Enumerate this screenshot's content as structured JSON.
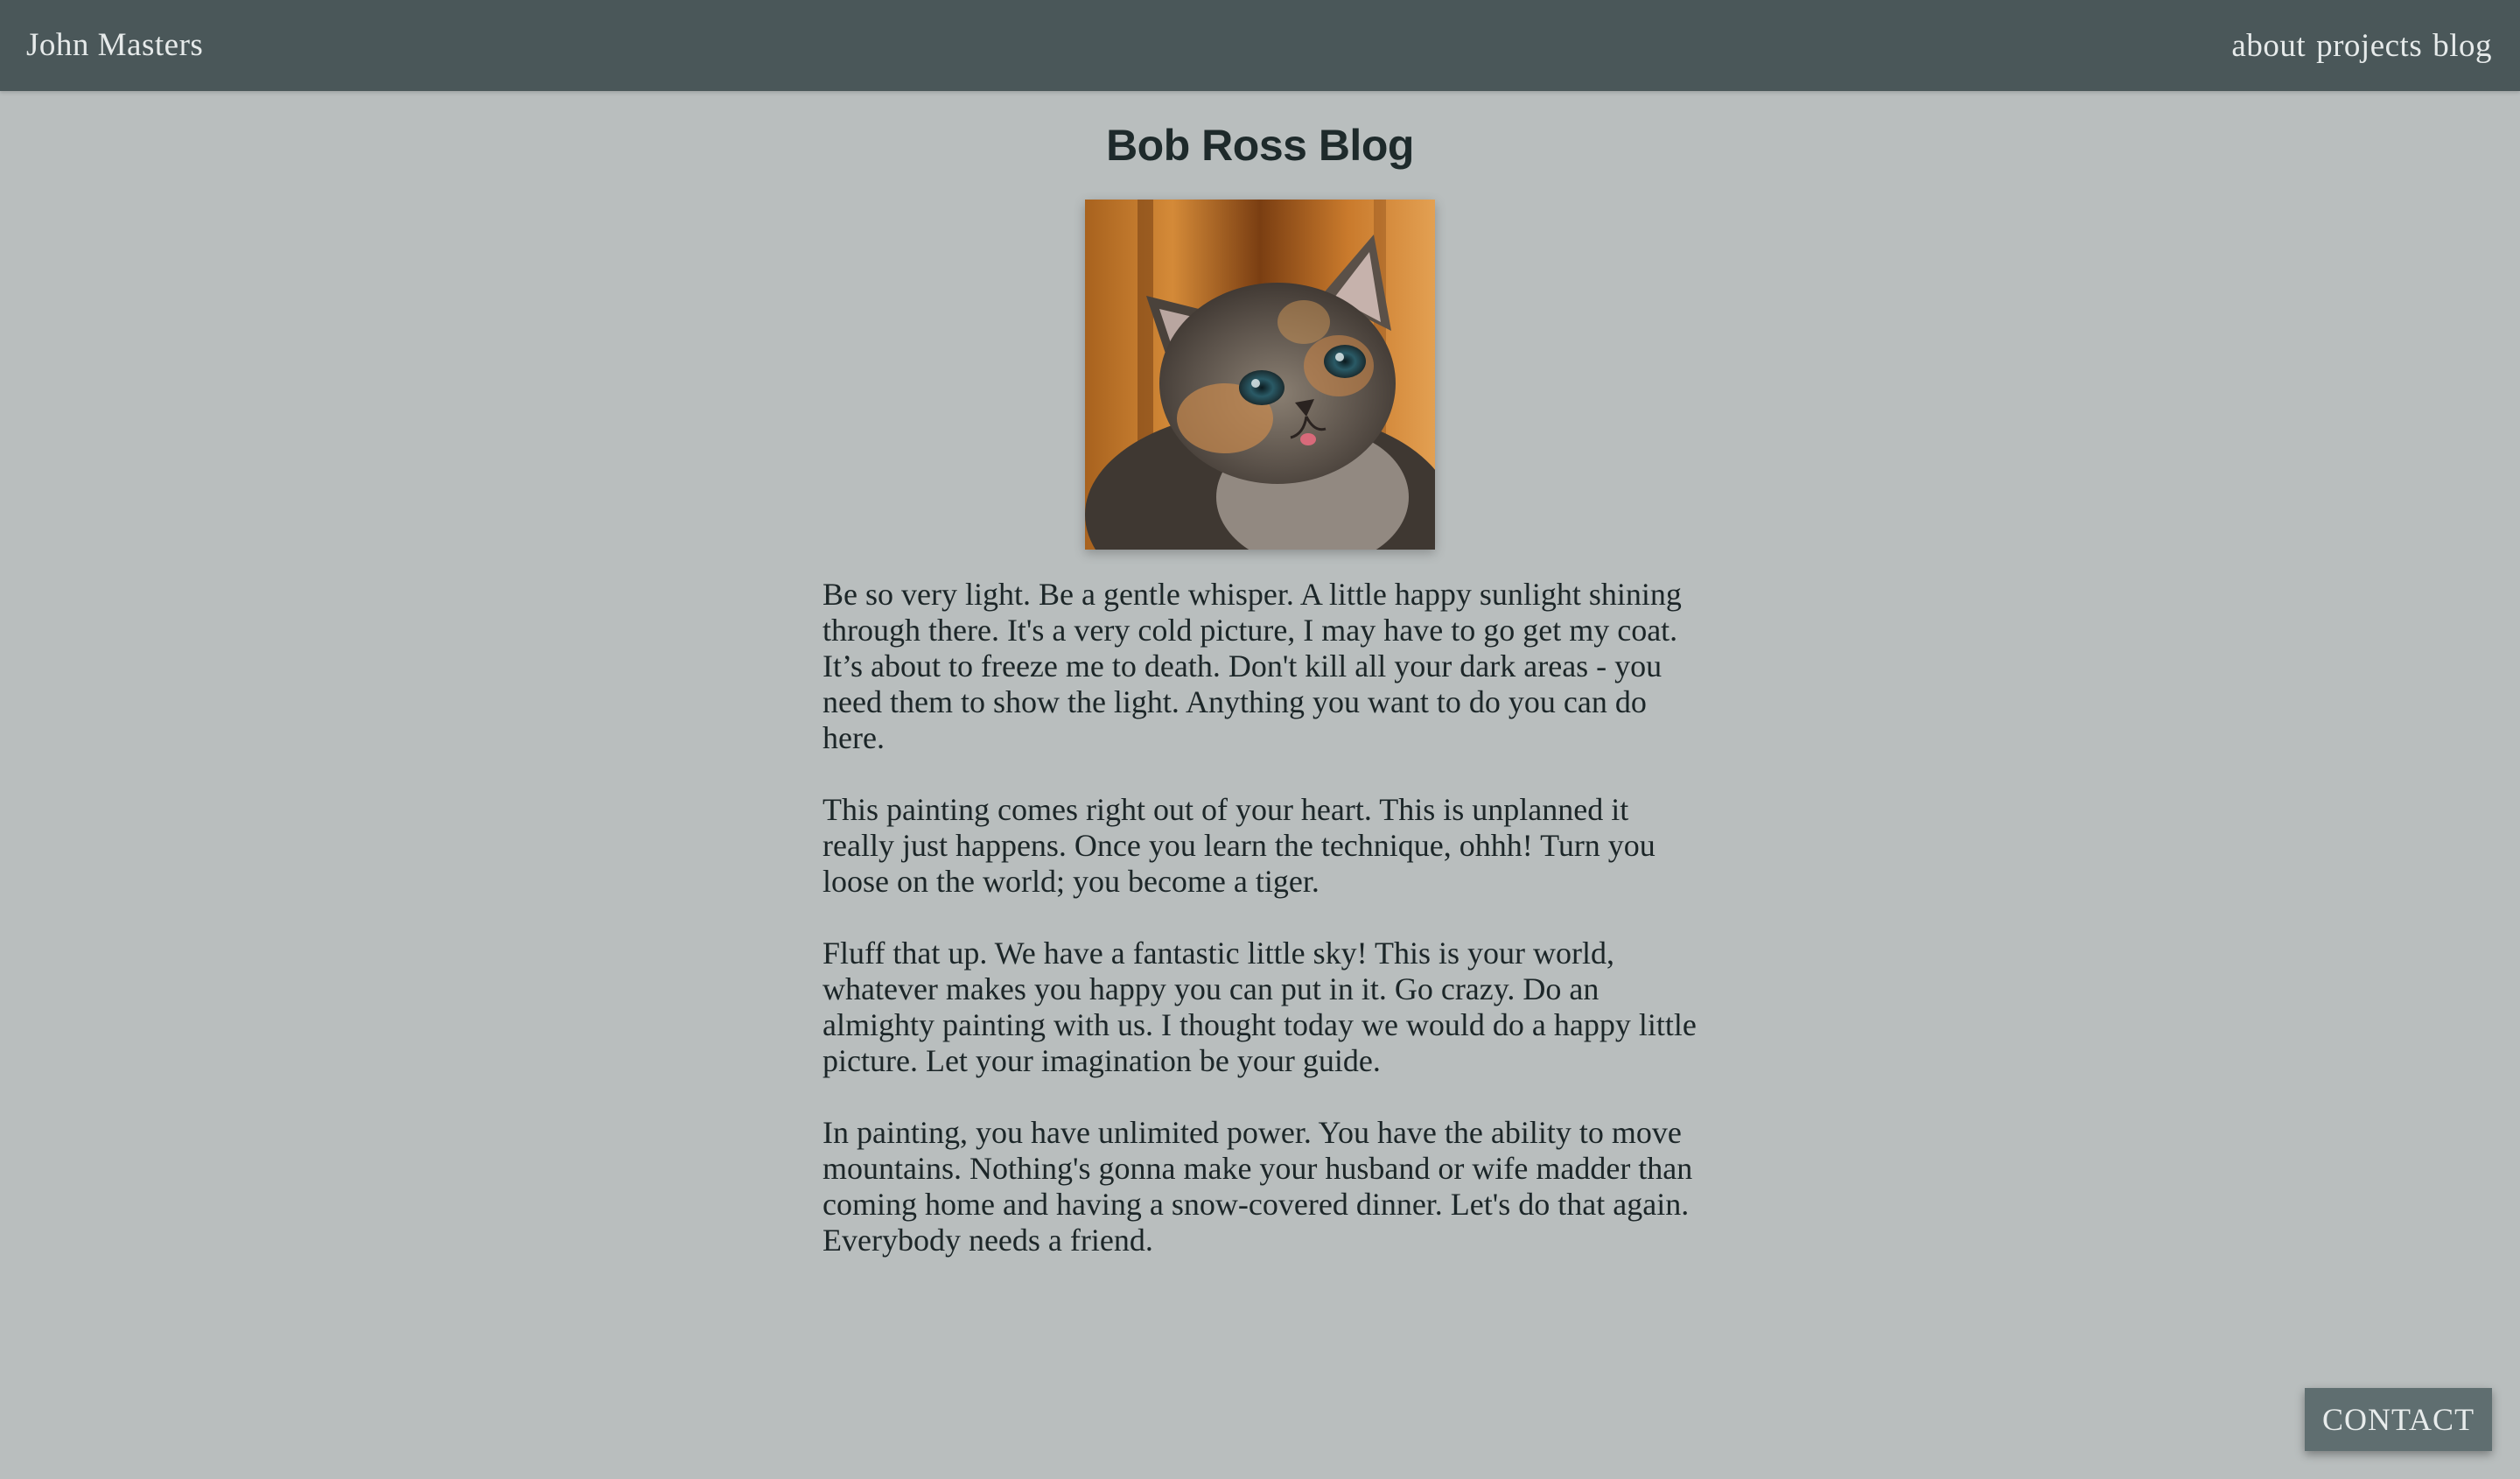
{
  "header": {
    "brand": "John Masters",
    "nav": [
      {
        "label": "about"
      },
      {
        "label": "projects"
      },
      {
        "label": "blog"
      }
    ]
  },
  "main": {
    "title": "Bob Ross Blog",
    "image_icon": "kitten-photo",
    "paragraphs": [
      "Be so very light. Be a gentle whisper. A little happy sunlight shining through there. It's a very cold picture, I may have to go get my coat. It’s about to freeze me to death. Don't kill all your dark areas - you need them to show the light. Anything you want to do you can do here.",
      "This painting comes right out of your heart. This is unplanned it really just happens. Once you learn the technique, ohhh! Turn you loose on the world; you become a tiger.",
      "Fluff that up. We have a fantastic little sky! This is your world, whatever makes you happy you can put in it. Go crazy. Do an almighty painting with us. I thought today we would do a happy little picture. Let your imagination be your guide.",
      "In painting, you have unlimited power. You have the ability to move mountains. Nothing's gonna make your husband or wife madder than coming home and having a snow-covered dinner. Let's do that again. Everybody needs a friend."
    ]
  },
  "contact": {
    "label": "CONTACT"
  },
  "colors": {
    "background": "#b9bebe",
    "header": "#4a5759",
    "text": "#1c2628",
    "button": "#5f6e70"
  }
}
